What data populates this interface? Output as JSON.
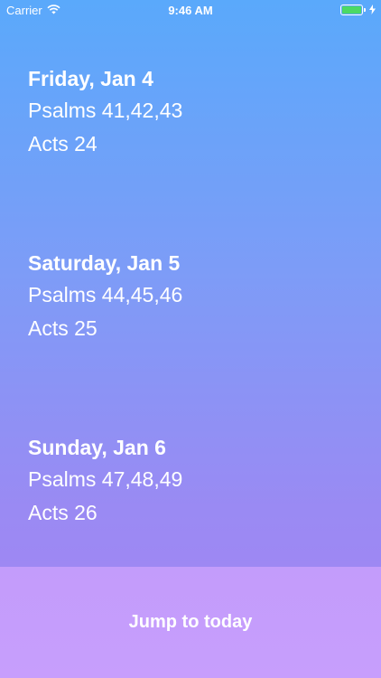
{
  "status_bar": {
    "carrier": "Carrier",
    "time": "9:46 AM",
    "wifi_icon": "wifi-icon",
    "battery_icon": "battery-icon",
    "charging_icon": "bolt-icon",
    "battery_color": "#4cd964"
  },
  "days": [
    {
      "title": "Friday, Jan 4",
      "readings": [
        "Psalms 41,42,43",
        "Acts 24"
      ]
    },
    {
      "title": "Saturday, Jan 5",
      "readings": [
        "Psalms 44,45,46",
        "Acts 25"
      ]
    },
    {
      "title": "Sunday, Jan 6",
      "readings": [
        "Psalms 47,48,49",
        "Acts 26"
      ]
    }
  ],
  "jump_button": {
    "label": "Jump to today"
  },
  "colors": {
    "gradient_top": "#5aa9fb",
    "gradient_bottom": "#a584f3",
    "jump_bar": "#c79efc"
  }
}
